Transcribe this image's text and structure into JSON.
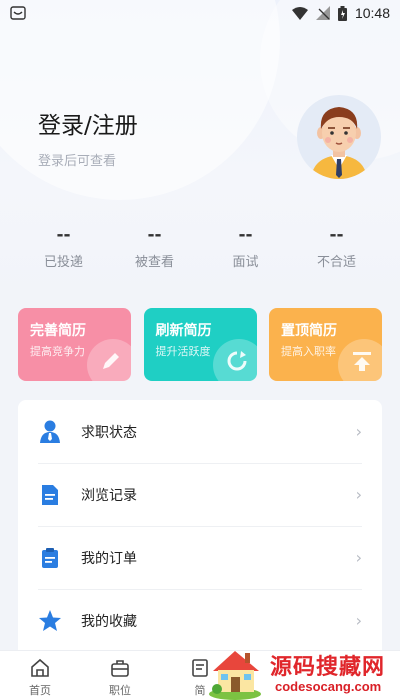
{
  "status_bar": {
    "time": "10:48"
  },
  "header": {
    "login_title": "登录/注册",
    "login_subtitle": "登录后可查看"
  },
  "stats": [
    {
      "value": "--",
      "label": "已投递"
    },
    {
      "value": "--",
      "label": "被查看"
    },
    {
      "value": "--",
      "label": "面试"
    },
    {
      "value": "--",
      "label": "不合适"
    }
  ],
  "cards": [
    {
      "title": "完善简历",
      "subtitle": "提高竞争力",
      "color": "#f78fa6",
      "icon": "pencil-icon"
    },
    {
      "title": "刷新简历",
      "subtitle": "提升活跃度",
      "color": "#1fcfc4",
      "icon": "refresh-icon"
    },
    {
      "title": "置顶简历",
      "subtitle": "提高入职率",
      "color": "#fbb24d",
      "icon": "pin-top-icon"
    }
  ],
  "menu": [
    {
      "label": "求职状态",
      "icon": "person-icon"
    },
    {
      "label": "浏览记录",
      "icon": "document-icon"
    },
    {
      "label": "我的订单",
      "icon": "order-icon"
    },
    {
      "label": "我的收藏",
      "icon": "star-icon"
    }
  ],
  "tabbar": [
    {
      "label": "首页",
      "icon": "home-icon"
    },
    {
      "label": "职位",
      "icon": "briefcase-icon"
    },
    {
      "label": "简",
      "icon": "resume-icon"
    }
  ],
  "watermark": {
    "title": "源码搜藏网",
    "url": "codesocang.com"
  },
  "colors": {
    "accent_blue": "#2a7de1",
    "background": "#f2f4f9"
  }
}
